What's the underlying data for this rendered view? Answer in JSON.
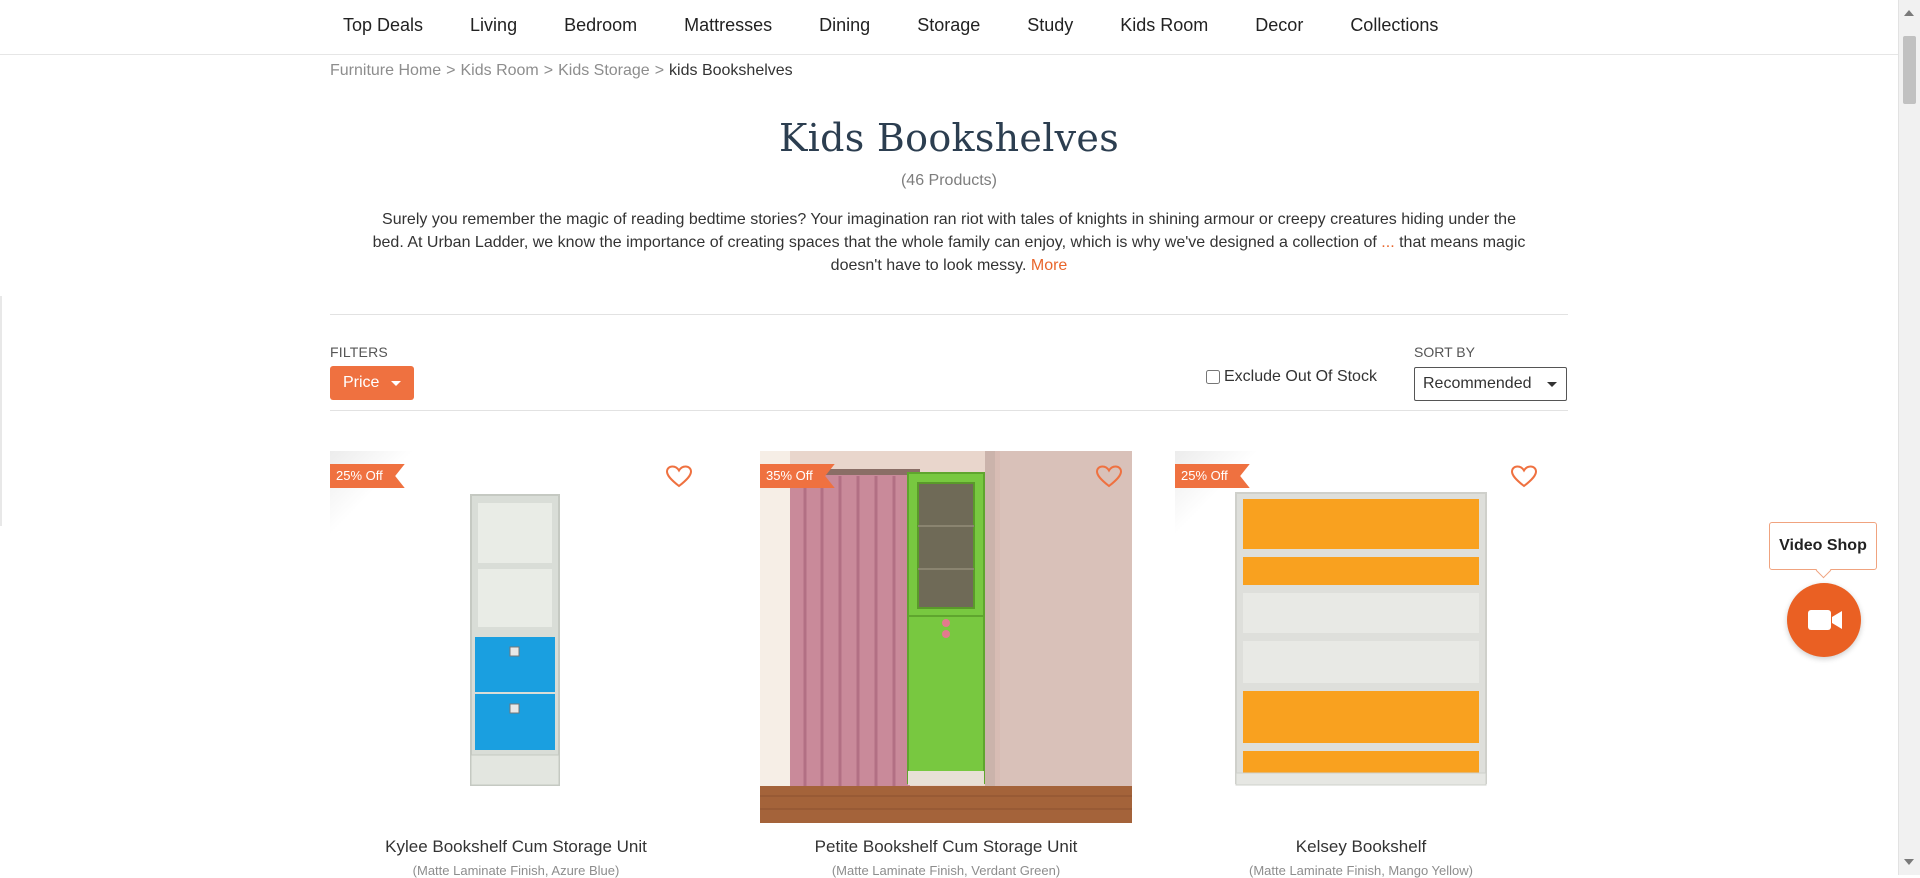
{
  "nav": {
    "items": [
      "Top Deals",
      "Living",
      "Bedroom",
      "Mattresses",
      "Dining",
      "Storage",
      "Study",
      "Kids Room",
      "Decor",
      "Collections"
    ]
  },
  "breadcrumb": {
    "items": [
      "Furniture Home",
      "Kids Room",
      "Kids Storage"
    ],
    "separator": ">",
    "current": "kids Bookshelves"
  },
  "page": {
    "title": "Kids Bookshelves",
    "count": "(46 Products)",
    "description_line1": "Surely you remember the magic of reading bedtime stories? Your imagination ran riot with tales of knights in shining armour or creepy creatures hiding under the",
    "description_line2": "bed. At Urban Ladder, we know the importance of creating spaces that the whole family can enjoy, which is why we've designed a collection of",
    "description_ellipsis": "...",
    "description_line2b": "that means magic",
    "description_line3": "doesn't have to look messy.",
    "more_link": "More"
  },
  "filters": {
    "label": "FILTERS",
    "price_button": "Price",
    "exclude_out_of_stock": "Exclude Out Of Stock",
    "exclude_checked": false,
    "sort_label": "SORT BY",
    "sort_selected": "Recommended"
  },
  "products": [
    {
      "name": "Kylee Bookshelf Cum Storage Unit",
      "variant": "(Matte Laminate Finish, Azure Blue)",
      "badge": "25% Off",
      "accent_color": "#1ca0e0"
    },
    {
      "name": "Petite Bookshelf Cum Storage Unit",
      "variant": "(Matte Laminate Finish, Verdant Green)",
      "badge": "35% Off",
      "accent_color": "#7ccf39"
    },
    {
      "name": "Kelsey Bookshelf",
      "variant": "(Matte Laminate Finish, Mango Yellow)",
      "badge": "25% Off",
      "accent_color": "#f9a11f"
    }
  ],
  "video_shop": {
    "label": "Video Shop",
    "icon": "video-camera-icon"
  },
  "colors": {
    "accent": "#ef7140",
    "video_button": "#ea6023",
    "title": "#2c3e50"
  }
}
